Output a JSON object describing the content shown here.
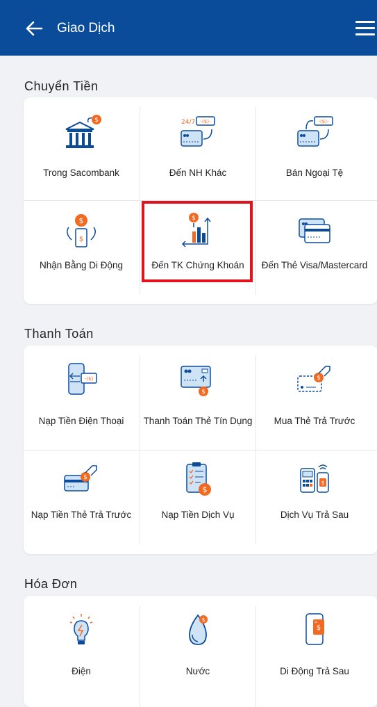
{
  "header": {
    "title": "Giao Dịch",
    "back_icon": "arrow-left-icon",
    "menu_icon": "hamburger-menu-icon",
    "bg_color": "#0b4c9a"
  },
  "sections": {
    "transfer": {
      "title": "Chuyển Tiền",
      "items": [
        {
          "label": "Trong Sacombank",
          "icon": "bank-transfer-icon"
        },
        {
          "label": "Đến NH Khác",
          "icon": "card-transfer-24-7-icon"
        },
        {
          "label": "Bán Ngoại Tệ",
          "icon": "card-foreign-currency-icon"
        },
        {
          "label": "Nhận Bằng Di Động",
          "icon": "mobile-receive-icon"
        },
        {
          "label": "Đến TK Chứng Khoán",
          "icon": "securities-account-icon"
        },
        {
          "label": "Đến Thẻ Visa/Mastercard",
          "icon": "credit-card-icon"
        }
      ]
    },
    "payment": {
      "title": "Thanh Toán",
      "items": [
        {
          "label": "Nạp Tiền Điện Thoại",
          "icon": "phone-topup-icon"
        },
        {
          "label": "Thanh Toán Thẻ Tín Dụng",
          "icon": "credit-card-payment-icon"
        },
        {
          "label": "Mua Thẻ Trả Trước",
          "icon": "buy-prepaid-card-icon"
        },
        {
          "label": "Nạp Tiền Thẻ Trả Trước",
          "icon": "prepaid-card-topup-icon"
        },
        {
          "label": "Nạp Tiền Dịch Vụ",
          "icon": "service-topup-icon"
        },
        {
          "label": "Dịch Vụ Trả Sau",
          "icon": "postpaid-service-icon"
        }
      ]
    },
    "bills": {
      "title": "Hóa Đơn",
      "items": [
        {
          "label": "Điện",
          "icon": "lightbulb-icon"
        },
        {
          "label": "Nước",
          "icon": "water-drop-icon"
        },
        {
          "label": "Di Động Trả Sau",
          "icon": "mobile-postpaid-icon"
        }
      ]
    }
  },
  "colors": {
    "accent_orange": "#f26a21",
    "brand_blue": "#0b4c9a",
    "highlight_red": "#e0141e"
  }
}
